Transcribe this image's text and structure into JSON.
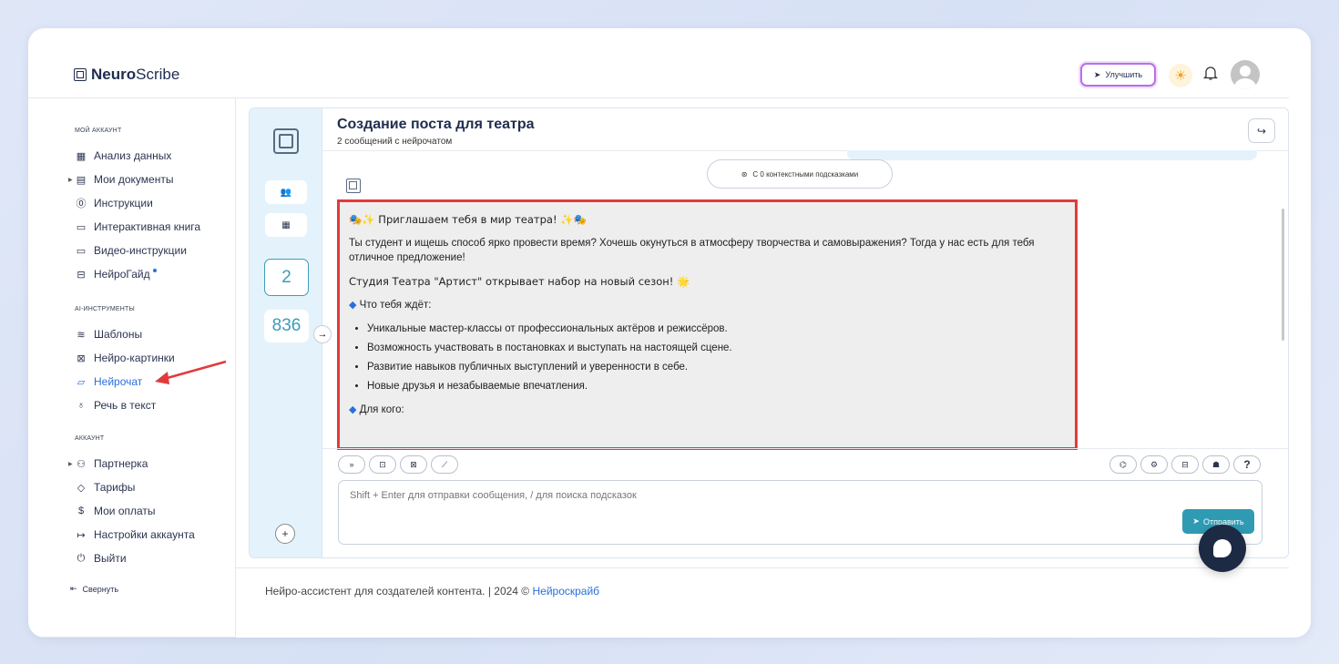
{
  "brand": {
    "name_bold": "Neuro",
    "name_light": "Scribe"
  },
  "header": {
    "upgrade_label": "Улучшить"
  },
  "sidebar": {
    "section_account": "МОЙ АККАУНТ",
    "account_items": [
      {
        "label": "Анализ данных",
        "icon": "grid-icon"
      },
      {
        "label": "Мои документы",
        "icon": "document-icon"
      },
      {
        "label": "Инструкции",
        "icon": "help-circle-icon"
      },
      {
        "label": "Интерактивная книга",
        "icon": "book-icon"
      },
      {
        "label": "Видео-инструкции",
        "icon": "video-icon"
      },
      {
        "label": "НейроГайд",
        "icon": "table-icon"
      }
    ],
    "section_ai": "AI-ИНСТРУМЕНТЫ",
    "ai_items": [
      {
        "label": "Шаблоны",
        "icon": "layers-icon"
      },
      {
        "label": "Нейро-картинки",
        "icon": "image-icon"
      },
      {
        "label": "Нейрочат",
        "icon": "chat-icon"
      },
      {
        "label": "Речь в текст",
        "icon": "headphones-icon"
      }
    ],
    "section_acc2": "АККАУНТ",
    "acc2_items": [
      {
        "label": "Партнерка",
        "icon": "users-icon"
      },
      {
        "label": "Тарифы",
        "icon": "tag-icon"
      },
      {
        "label": "Мои оплаты",
        "icon": "dollar-icon"
      },
      {
        "label": "Настройки аккаунта",
        "icon": "login-icon"
      },
      {
        "label": "Выйти",
        "icon": "power-icon"
      }
    ],
    "collapse_label": "Свернуть"
  },
  "chat": {
    "title": "Создание поста для театра",
    "subtitle": "2 сообщений с нейрочатом",
    "strip_count_box": "2",
    "strip_count": "836",
    "context_pill": "С 0 контекстными подсказками",
    "message": {
      "heading": "🎭✨ Приглашаем тебя в мир театра! ✨🎭",
      "p1": "Ты студент и ищешь способ ярко провести время? Хочешь окунуться в атмосферу творчества и самовыражения? Тогда у нас есть для тебя отличное предложение!",
      "p2": "Студия Театра \"Артист\" открывает набор на новый сезон! 🌟",
      "section1": "Что тебя ждёт:",
      "bullets": [
        "Уникальные мастер-классы от профессиональных актёров и режиссёров.",
        "Возможность участвовать в постановках и выступать на настоящей сцене.",
        "Развитие навыков публичных выступлений и уверенности в себе.",
        "Новые друзья и незабываемые впечатления."
      ],
      "section2": "Для кого:"
    },
    "input_placeholder": "Shift + Enter для отправки сообщения, / для поиска подсказок",
    "send_label": "Отправить",
    "help_label": "?"
  },
  "footer": {
    "text": "Нейро-ассистент для создателей контента.  | 2024 © ",
    "link": "Нейроскрайб"
  },
  "colors": {
    "accent": "#2a6fdb",
    "teal": "#2e9bb3",
    "highlight": "#e23a3a"
  }
}
